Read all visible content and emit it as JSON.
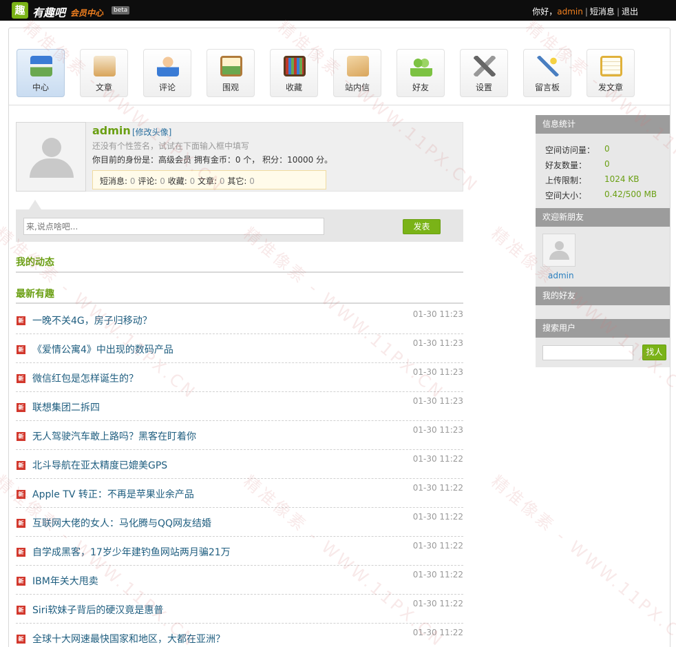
{
  "topbar": {
    "logo_mark": "趣",
    "logo_name": "有趣吧",
    "logo_sub": "会员中心",
    "beta": "beta",
    "greeting": "你好，",
    "username": "admin",
    "sep1": "|",
    "messages": "短消息",
    "sep2": "|",
    "logout": "退出"
  },
  "nav": {
    "items": [
      {
        "label": "中心",
        "icon": "store-icon",
        "color": "#3a7bd5"
      },
      {
        "label": "文章",
        "icon": "mail-tray-icon",
        "color": "#d9a55b"
      },
      {
        "label": "评论",
        "icon": "user-icon",
        "color": "#e98b3a"
      },
      {
        "label": "围观",
        "icon": "picture-icon",
        "color": "#6aa84f"
      },
      {
        "label": "收藏",
        "icon": "bookshelf-icon",
        "color": "#8a5a2b"
      },
      {
        "label": "站内信",
        "icon": "envelope-icon",
        "color": "#d9a55b"
      },
      {
        "label": "好友",
        "icon": "friends-icon",
        "color": "#7cc242"
      },
      {
        "label": "设置",
        "icon": "tools-icon",
        "color": "#666666"
      },
      {
        "label": "留言板",
        "icon": "magic-wand-icon",
        "color": "#4a7fc1"
      },
      {
        "label": "发文章",
        "icon": "clipboard-icon",
        "color": "#e0b13a"
      }
    ]
  },
  "profile": {
    "name": "admin",
    "edit_avatar": "[修改头像]",
    "signature": "还没有个性签名，试试在下面输入框中填写",
    "identity": "你目前的身份是：高级会员 拥有金币：0 个， 积分：10000 分。",
    "stats": {
      "messages_label": "短消息:",
      "messages": "0",
      "comments_label": "评论:",
      "comments": "0",
      "favorites_label": "收藏:",
      "favorites": "0",
      "articles_label": "文章:",
      "articles": "0",
      "other_label": "其它:",
      "other": "0"
    }
  },
  "post": {
    "placeholder": "来,说点啥吧...",
    "button": "发表"
  },
  "sections": {
    "my_activity": "我的动态",
    "latest": "最新有趣"
  },
  "news_badge": "新",
  "news": [
    {
      "title": "一晚不关4G，房子归移动？",
      "time": "01-30 11:23"
    },
    {
      "title": "《爱情公寓4》中出现的数码产品",
      "time": "01-30 11:23"
    },
    {
      "title": "微信红包是怎样诞生的？",
      "time": "01-30 11:23"
    },
    {
      "title": "联想集团二拆四",
      "time": "01-30 11:23"
    },
    {
      "title": "无人驾驶汽车敢上路吗？黑客在盯着你",
      "time": "01-30 11:23"
    },
    {
      "title": "北斗导航在亚太精度已媲美GPS",
      "time": "01-30 11:22"
    },
    {
      "title": "Apple TV 转正：不再是苹果业余产品",
      "time": "01-30 11:22"
    },
    {
      "title": "互联网大佬的女人：马化腾与QQ网友结婚",
      "time": "01-30 11:22"
    },
    {
      "title": "自学成黑客，17岁少年建钓鱼网站两月骗21万",
      "time": "01-30 11:22"
    },
    {
      "title": "IBM年关大甩卖",
      "time": "01-30 11:22"
    },
    {
      "title": "Siri软妹子背后的硬汉竟是惠普",
      "time": "01-30 11:22"
    },
    {
      "title": "全球十大网速最快国家和地区，大都在亚洲？",
      "time": "01-30 11:22"
    }
  ],
  "sidebar": {
    "info_title": "信息统计",
    "stats": [
      {
        "label": "空间访问量：",
        "value": "0"
      },
      {
        "label": "好友数量：",
        "value": "0"
      },
      {
        "label": "上传限制：",
        "value": "1024 KB"
      },
      {
        "label": "空间大小：",
        "value": "0.42/500 MB"
      }
    ],
    "welcome_title": "欢迎新朋友",
    "new_friend": "admin",
    "my_friends_title": "我的好友",
    "search_title": "搜索用户",
    "search_button": "找人"
  },
  "watermark": {
    "text": "精准像素 - WWW.11PX.CN"
  },
  "colors": {
    "brand_green": "#6a9f13",
    "button_green": "#7ab317",
    "accent_orange": "#f2801f",
    "link_blue": "#1e5d7f"
  }
}
